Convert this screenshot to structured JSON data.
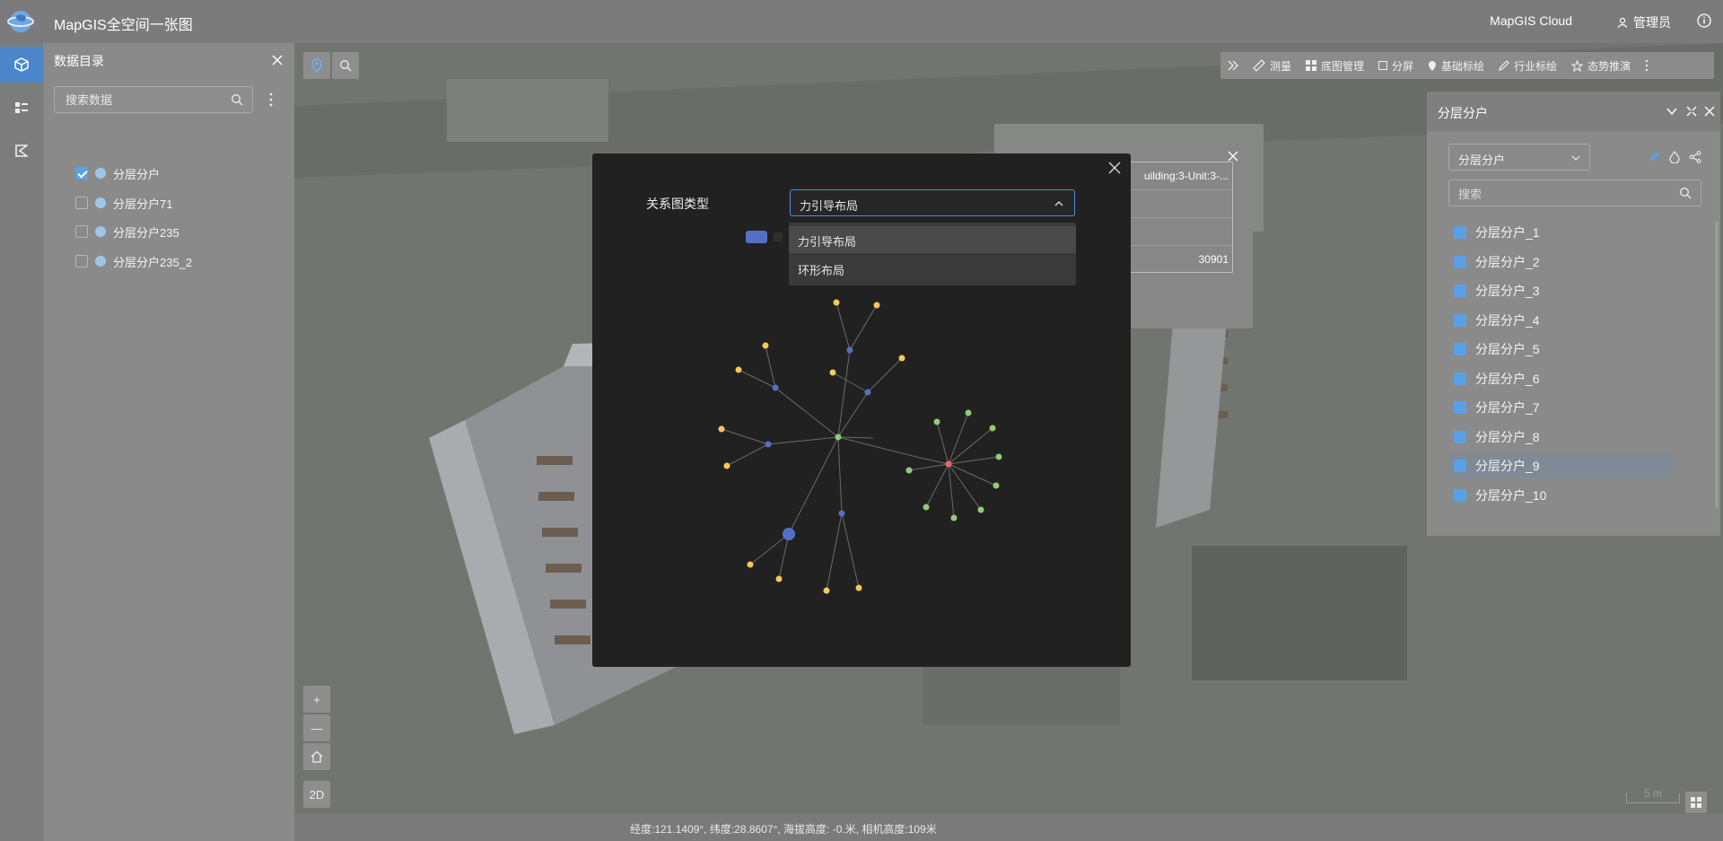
{
  "topbar": {
    "title": "MapGIS全空间一张图",
    "brand": "MapGIS Cloud",
    "user": "管理员"
  },
  "catalog": {
    "title": "数据目录",
    "search_placeholder": "搜索数据",
    "items": [
      {
        "label": "分层分户",
        "checked": true
      },
      {
        "label": "分层分户71",
        "checked": false
      },
      {
        "label": "分层分户235",
        "checked": false
      },
      {
        "label": "分层分户235_2",
        "checked": false
      }
    ]
  },
  "map": {
    "zoom_in": "+",
    "zoom_out": "—",
    "mode_2d": "2D",
    "scale": "5 m"
  },
  "toolbar": {
    "items": [
      "测量",
      "底图管理",
      "分屏",
      "基础标绘",
      "行业标绘",
      "态势推演"
    ]
  },
  "status": {
    "coords": "经度:121.1409°, 纬度:28.8607°, 海拔高度: -0.米, 相机高度:109米"
  },
  "right_panel": {
    "title": "分层分户",
    "select_value": "分层分户",
    "search_placeholder": "搜索",
    "items": [
      "分层分户_1",
      "分层分户_2",
      "分层分户_3",
      "分层分户_4",
      "分层分户_5",
      "分层分户_6",
      "分层分户_7",
      "分层分户_8",
      "分层分户_9",
      "分层分户_10"
    ],
    "highlighted": "分层分户_9"
  },
  "popup": {
    "row1": "uilding:3-Unit:3-...",
    "row4": "30901"
  },
  "modal": {
    "label": "关系图类型",
    "selected": "力引导布局",
    "options": [
      "力引导布局",
      "环形布局"
    ]
  },
  "colors": {
    "accent": "#4a86c9",
    "node_blue": "#5470c6",
    "node_yellow": "#fac858",
    "node_green": "#91cc75",
    "node_red": "#ee6666"
  }
}
